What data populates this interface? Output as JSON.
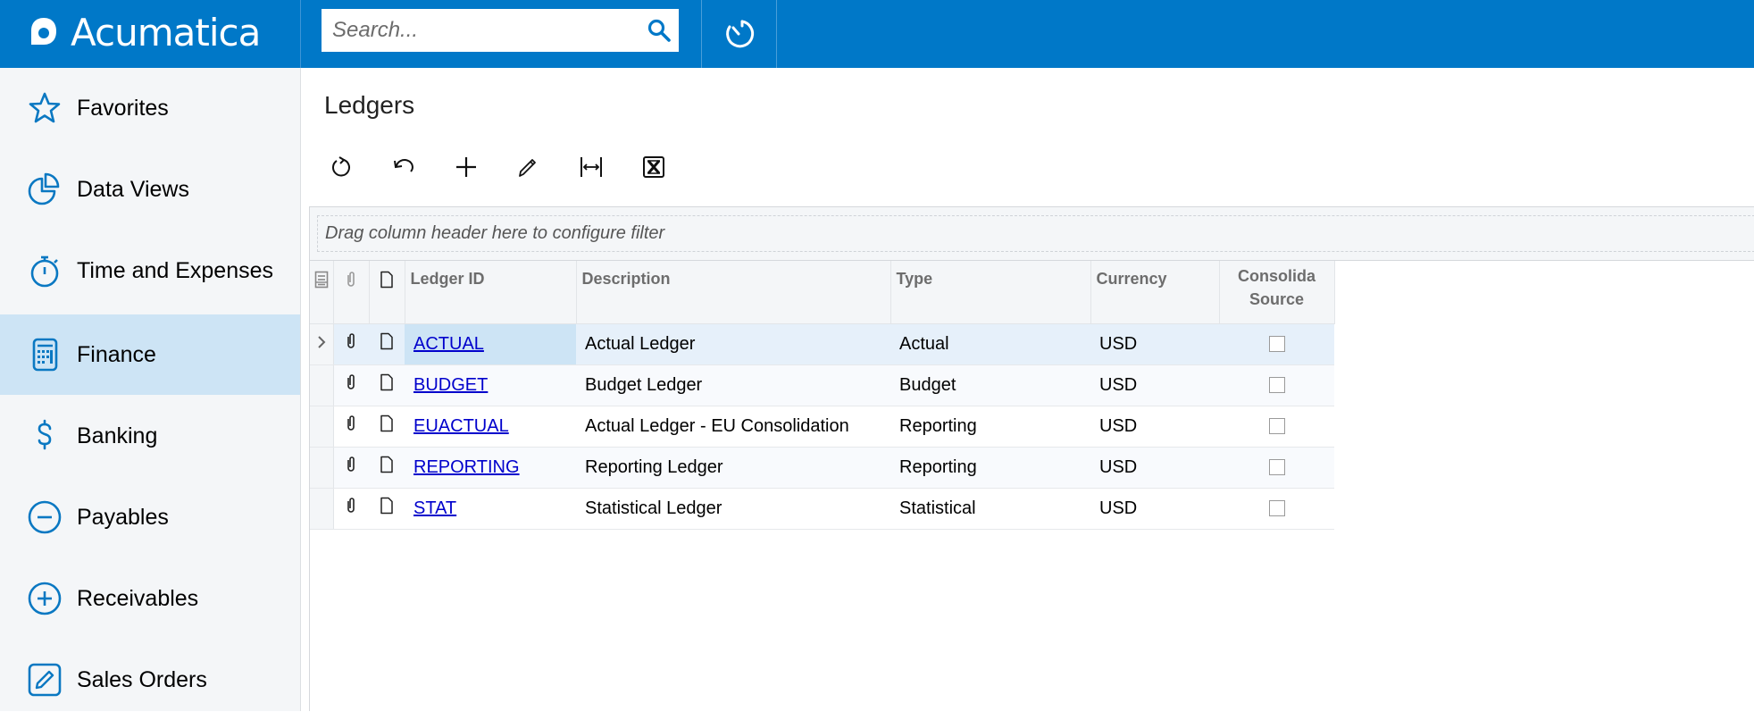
{
  "header": {
    "brand": "Acumatica",
    "search_placeholder": "Search...",
    "brand_color": "#0078c8"
  },
  "sidebar": {
    "items": [
      {
        "label": "Favorites",
        "icon": "star-icon",
        "active": false
      },
      {
        "label": "Data Views",
        "icon": "pie-chart-icon",
        "active": false
      },
      {
        "label": "Time and Expenses",
        "icon": "stopwatch-icon",
        "active": false
      },
      {
        "label": "Finance",
        "icon": "calculator-icon",
        "active": true
      },
      {
        "label": "Banking",
        "icon": "dollar-icon",
        "active": false
      },
      {
        "label": "Payables",
        "icon": "minus-circle-icon",
        "active": false
      },
      {
        "label": "Receivables",
        "icon": "plus-circle-icon",
        "active": false
      },
      {
        "label": "Sales Orders",
        "icon": "edit-square-icon",
        "active": false
      }
    ]
  },
  "page": {
    "title": "Ledgers",
    "toolbar": [
      "refresh-icon",
      "undo-icon",
      "add-icon",
      "edit-icon",
      "fit-columns-icon",
      "export-excel-icon"
    ]
  },
  "grid": {
    "filter_hint": "Drag column header here to configure filter",
    "columns": [
      "Ledger ID",
      "Description",
      "Type",
      "Currency",
      "Consolida Source"
    ],
    "rows": [
      {
        "ledger_id": "ACTUAL",
        "description": "Actual Ledger",
        "type": "Actual",
        "currency": "USD",
        "consolidation_source": false,
        "selected": true
      },
      {
        "ledger_id": "BUDGET",
        "description": "Budget Ledger",
        "type": "Budget",
        "currency": "USD",
        "consolidation_source": false,
        "selected": false
      },
      {
        "ledger_id": "EUACTUAL",
        "description": "Actual Ledger - EU Consolidation",
        "type": "Reporting",
        "currency": "USD",
        "consolidation_source": false,
        "selected": false
      },
      {
        "ledger_id": "REPORTING",
        "description": "Reporting Ledger",
        "type": "Reporting",
        "currency": "USD",
        "consolidation_source": false,
        "selected": false
      },
      {
        "ledger_id": "STAT",
        "description": "Statistical Ledger",
        "type": "Statistical",
        "currency": "USD",
        "consolidation_source": false,
        "selected": false
      }
    ]
  }
}
